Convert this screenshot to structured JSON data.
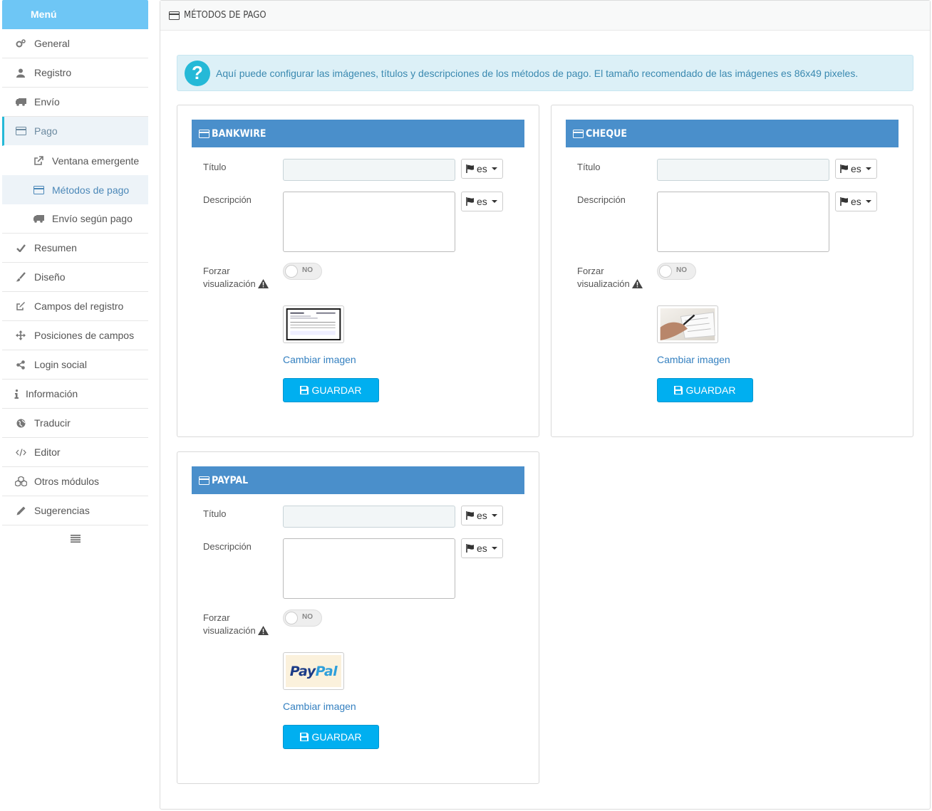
{
  "sidebar": {
    "header": "Menú",
    "items": [
      {
        "label": "General"
      },
      {
        "label": "Registro"
      },
      {
        "label": "Envío"
      },
      {
        "label": "Pago"
      },
      {
        "label": "Ventana emergente"
      },
      {
        "label": "Métodos de pago"
      },
      {
        "label": "Envío según pago"
      },
      {
        "label": "Resumen"
      },
      {
        "label": "Diseño"
      },
      {
        "label": "Campos del registro"
      },
      {
        "label": "Posiciones de campos"
      },
      {
        "label": "Login social"
      },
      {
        "label": "Información"
      },
      {
        "label": "Traducir"
      },
      {
        "label": "Editor"
      },
      {
        "label": "Otros módulos"
      },
      {
        "label": "Sugerencias"
      }
    ]
  },
  "main": {
    "title": "MÉTODOS DE PAGO",
    "info": "Aquí puede configurar las imágenes, títulos y descripciones de los métodos de pago. El tamaño recomendado de las imágenes es 86x49 pixeles.",
    "labels": {
      "title": "Título",
      "description": "Descripción",
      "force1": "Forzar",
      "force2": "visualización",
      "toggle": "NO",
      "lang": "es",
      "change_image": "Cambiar imagen",
      "save": "GUARDAR"
    },
    "methods": [
      {
        "name": "BANKWIRE",
        "title_value": "",
        "description_value": ""
      },
      {
        "name": "CHEQUE",
        "title_value": "",
        "description_value": ""
      },
      {
        "name": "PAYPAL",
        "title_value": "",
        "description_value": "",
        "logo_text_1": "Pay",
        "logo_text_2": "Pal"
      }
    ]
  },
  "colors": {
    "accent": "#25b9d7",
    "card_header": "#4a8fcb",
    "save_button": "#00aff0",
    "menu_header": "#6ec6f5"
  }
}
